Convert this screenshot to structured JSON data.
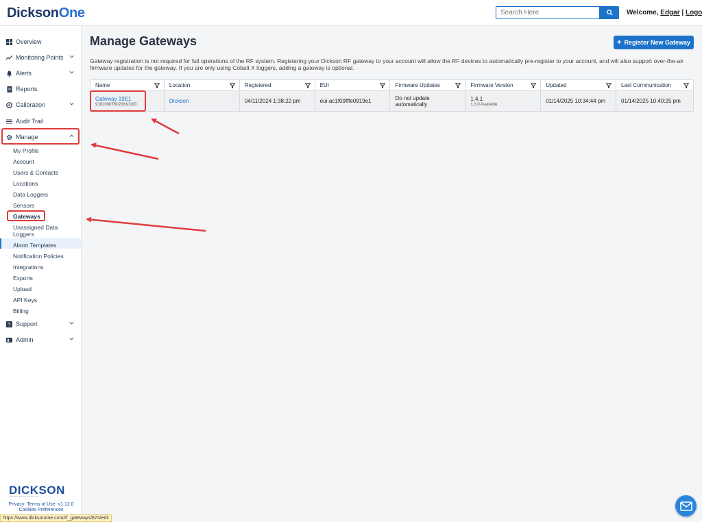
{
  "header": {
    "logo_main": "Dickson",
    "logo_accent": "One",
    "search_placeholder": "Search Here",
    "welcome_prefix": "Welcome, ",
    "user": "Edgar",
    "separator": " | ",
    "logout": "Logout"
  },
  "sidebar": {
    "items": [
      {
        "label": "Overview",
        "icon": "dashboard-icon"
      },
      {
        "label": "Monitoring Points",
        "icon": "trend-icon"
      },
      {
        "label": "Alerts",
        "icon": "bell-icon"
      },
      {
        "label": "Reports",
        "icon": "document-icon"
      },
      {
        "label": "Calibration",
        "icon": "gauge-icon"
      },
      {
        "label": "Audit Trail",
        "icon": "list-icon"
      },
      {
        "label": "Manage",
        "icon": "gear-icon"
      },
      {
        "label": "Support",
        "icon": "question-icon"
      },
      {
        "label": "Admin",
        "icon": "id-card-icon"
      }
    ],
    "manage_sub": [
      "My Profile",
      "Account",
      "Users & Contacts",
      "Locations",
      "Data Loggers",
      "Sensors",
      "Gateways",
      "Unassigned Data Loggers",
      "Alarm Templates",
      "Notification Policies",
      "Integrations",
      "Exports",
      "Upload",
      "API Keys",
      "Billing"
    ],
    "brand": "DICKSON",
    "brand_tagline": "Environmental Monitoring & Compliance Experts",
    "footer": {
      "privacy": "Privacy",
      "terms": "Terms of Use",
      "version": "v1.12.0",
      "cookies": "Cookies Preferences"
    }
  },
  "status_url": "https://www.dicksonone.com/rf_gateways/874/edit",
  "main": {
    "title": "Manage Gateways",
    "register_button": "Register New Gateway",
    "description": "Gateway registration is not required for full operations of the RF system. Registering your Dickson RF gateway to your account will allow the RF devices to automatically pre-register to your account, and will also support over-the-air firmware updates for the gateway. If you are only using Cobalt X loggers, adding a gateway is optional.",
    "table": {
      "columns": [
        "Name",
        "Location",
        "Registered",
        "EUI",
        "Firmware Updates",
        "Firmware Version",
        "Updated",
        "Last Communication"
      ],
      "rows": [
        {
          "name": "Gateway 19E1",
          "serial": "9181000T6020810100",
          "location": "Dickson",
          "registered": "04/11/2024 1:38:22 pm",
          "eui": "eui-ac1f09fffe0919e1",
          "firmware_updates": "Do not update automatically",
          "firmware_version": "1.4.1",
          "firmware_available": "1.3.0 Available",
          "updated": "01/14/2025 10:34:44 pm",
          "last_communication": "01/14/2025 10:40:25 pm"
        }
      ]
    }
  },
  "colors": {
    "accent": "#1c73c9",
    "highlight": "#e03b3b",
    "navy": "#1e3a66"
  }
}
